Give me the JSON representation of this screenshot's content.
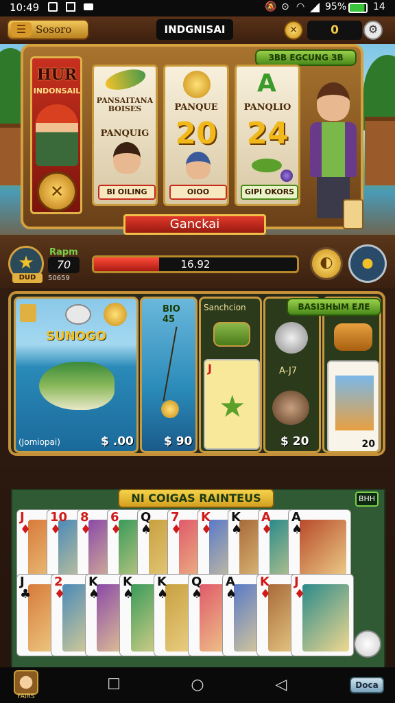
{
  "status_bar": {
    "time": "10:49",
    "battery": "95%",
    "extra": "14"
  },
  "top_bar": {
    "menu_label": "Sosoro",
    "title": "INDGNISAI",
    "coins": "0"
  },
  "machine": {
    "logo_line1": "HUR",
    "logo_line2": "INDONSAIL",
    "top_pill": "ЗВВ ЕGCUNG ЗВ",
    "reels": [
      {
        "title": "PANSAITANA BOISES",
        "caption": "PANQUIG",
        "pill": "BI OILING"
      },
      {
        "title": "PANQUE",
        "value": "20",
        "pill": "OIOO"
      },
      {
        "title": "PANQLIO",
        "value": "24",
        "pill": "GIPI OKORS"
      }
    ],
    "action_label": "Ganckai"
  },
  "hud": {
    "club_label": "DUD",
    "rapm_label": "Rapm",
    "level_value": "70",
    "sub_value": "50659",
    "progress_value": "16.92",
    "progress_fraction": 0.32
  },
  "shop": {
    "chip_label": "BASIЗНЫМ ЕЛЕ",
    "items": [
      {
        "title": "SUNOGO",
        "caption": "(Jomiopai)",
        "price": "$ .00"
      },
      {
        "title": "BIO 45",
        "price": "$ 90"
      },
      {
        "title": "Sanchcion",
        "price": ""
      },
      {
        "title": "A-J7",
        "price": "$ 20"
      },
      {
        "title": "",
        "price": "20"
      }
    ]
  },
  "table": {
    "title": "NI COIGAS RAINTEUS",
    "chip": "BHH",
    "top_row": [
      {
        "rank": "J",
        "suit": "♦",
        "color": "red"
      },
      {
        "rank": "10",
        "suit": "♦",
        "color": "red"
      },
      {
        "rank": "8",
        "suit": "♦",
        "color": "red"
      },
      {
        "rank": "6",
        "suit": "♦",
        "color": "red"
      },
      {
        "rank": "Q",
        "suit": "♠",
        "color": "black"
      },
      {
        "rank": "7",
        "suit": "♦",
        "color": "red"
      },
      {
        "rank": "K",
        "suit": "♦",
        "color": "red"
      },
      {
        "rank": "K",
        "suit": "♠",
        "color": "black"
      },
      {
        "rank": "A",
        "suit": "♦",
        "color": "red"
      },
      {
        "rank": "A",
        "suit": "♠",
        "color": "black"
      }
    ],
    "bottom_row": [
      {
        "rank": "J",
        "suit": "♣",
        "color": "black"
      },
      {
        "rank": "2",
        "suit": "♦",
        "color": "red"
      },
      {
        "rank": "K",
        "suit": "♠",
        "color": "black"
      },
      {
        "rank": "K",
        "suit": "♠",
        "color": "black"
      },
      {
        "rank": "K",
        "suit": "♠",
        "color": "black"
      },
      {
        "rank": "Q",
        "suit": "♠",
        "color": "black"
      },
      {
        "rank": "A",
        "suit": "♠",
        "color": "black"
      },
      {
        "rank": "K",
        "suit": "♦",
        "color": "red"
      },
      {
        "rank": "J",
        "suit": "♦",
        "color": "red"
      }
    ]
  },
  "nav": {
    "profile_label": "FAIRS",
    "dock_label": "Doca"
  }
}
